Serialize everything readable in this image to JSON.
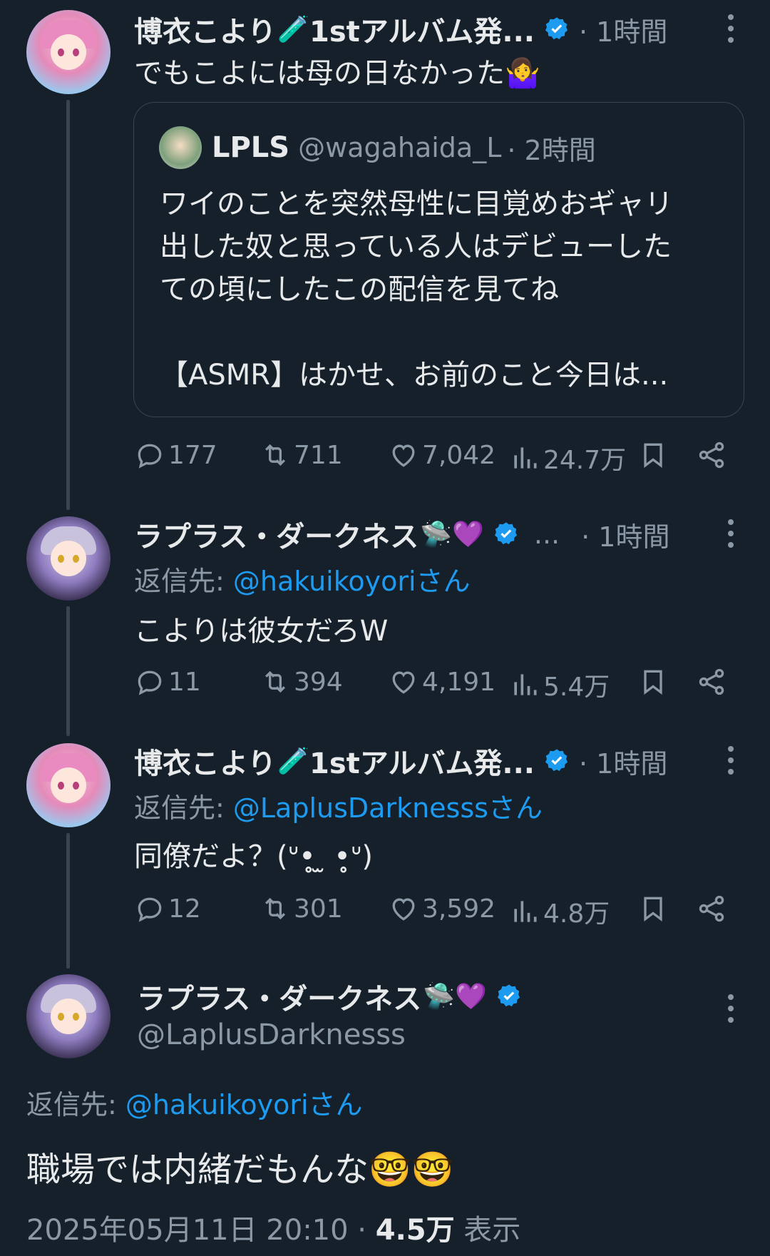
{
  "tweets": [
    {
      "name": "博衣こより",
      "name_emoji": "🧪",
      "name_suffix": "1stアルバム発...",
      "time": "· 1時間",
      "text": "でもこよには母の日なかった",
      "text_emoji": "🤷‍♀️",
      "metrics": {
        "replies": "177",
        "retweets": "711",
        "likes": "7,042",
        "views": "24.7万"
      }
    },
    {
      "name": "ラプラス・ダークネス",
      "name_emoji": "🛸💜",
      "trunc": "...",
      "time": "· 1時間",
      "reply_prefix": "返信先: ",
      "reply_mention": "@hakuikoyoriさん",
      "text": "こよりは彼女だろW",
      "metrics": {
        "replies": "11",
        "retweets": "394",
        "likes": "4,191",
        "views": "5.4万"
      }
    },
    {
      "name": "博衣こより",
      "name_emoji": "🧪",
      "name_suffix": "1stアルバム発...",
      "time": "· 1時間",
      "reply_prefix": "返信先: ",
      "reply_mention": "@LaplusDarknesssさん",
      "text": "同僚だよ？(ᐡ•̥̥̥ ̫ •̥̥̥ᐡ)",
      "metrics": {
        "replies": "12",
        "retweets": "301",
        "likes": "3,592",
        "views": "4.8万"
      }
    }
  ],
  "quote": {
    "name": "LPLS",
    "handle": "@wagahaida_L",
    "time": "· 2時間",
    "lines": [
      "ワイのことを突然母性に目覚めおギャリ",
      "出した奴と思っている人はデビューした",
      "ての頃にしたこの配信を見てね"
    ],
    "last_line": "【ASMR】はかせ、お前のこと今日は..."
  },
  "main": {
    "name": "ラプラス・ダークネス",
    "name_emoji": "🛸💜",
    "handle": "@LaplusDarknesss",
    "reply_prefix": "返信先: ",
    "reply_mention": "@hakuikoyoriさん",
    "text": "職場では内緒だもんな",
    "text_emoji": "🤓🤓",
    "date": "2025年05月11日 20:10 · ",
    "views": "4.5万",
    "views_label": " 表示"
  },
  "colors": {
    "background": "#15202b",
    "accent": "#1d9bf0",
    "muted": "#8b98a5",
    "text": "#e7e9ea"
  }
}
